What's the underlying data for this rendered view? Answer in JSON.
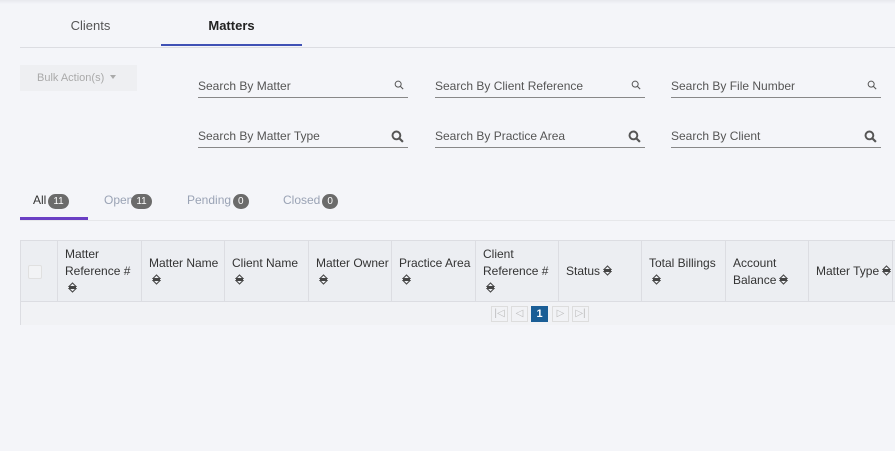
{
  "tabs": [
    "Clients",
    "Matters"
  ],
  "active_tab": "Matters",
  "bulk_action": "Bulk Action(s)",
  "searches": [
    "Search By Matter",
    "Search By Client Reference",
    "Search By File Number",
    "Search By Matter Type",
    "Search By Practice Area",
    "Search By Client"
  ],
  "status_tabs": [
    {
      "label": "All",
      "count": "11"
    },
    {
      "label": "Open",
      "count": "11"
    },
    {
      "label": "Pending",
      "count": "0"
    },
    {
      "label": "Closed",
      "count": "0"
    }
  ],
  "columns": [
    "Matter Reference #",
    "Matter Name",
    "Client Name",
    "Matter Owner",
    "Practice Area",
    "Client Reference #",
    "Status",
    "Total Billings",
    "Account Balance",
    "Matter Type"
  ],
  "pager": {
    "current": "1"
  },
  "colors": {
    "tab_underline": "#3f51b5",
    "status_underline": "#6a3fc4",
    "page_active": "#1a5e96"
  }
}
